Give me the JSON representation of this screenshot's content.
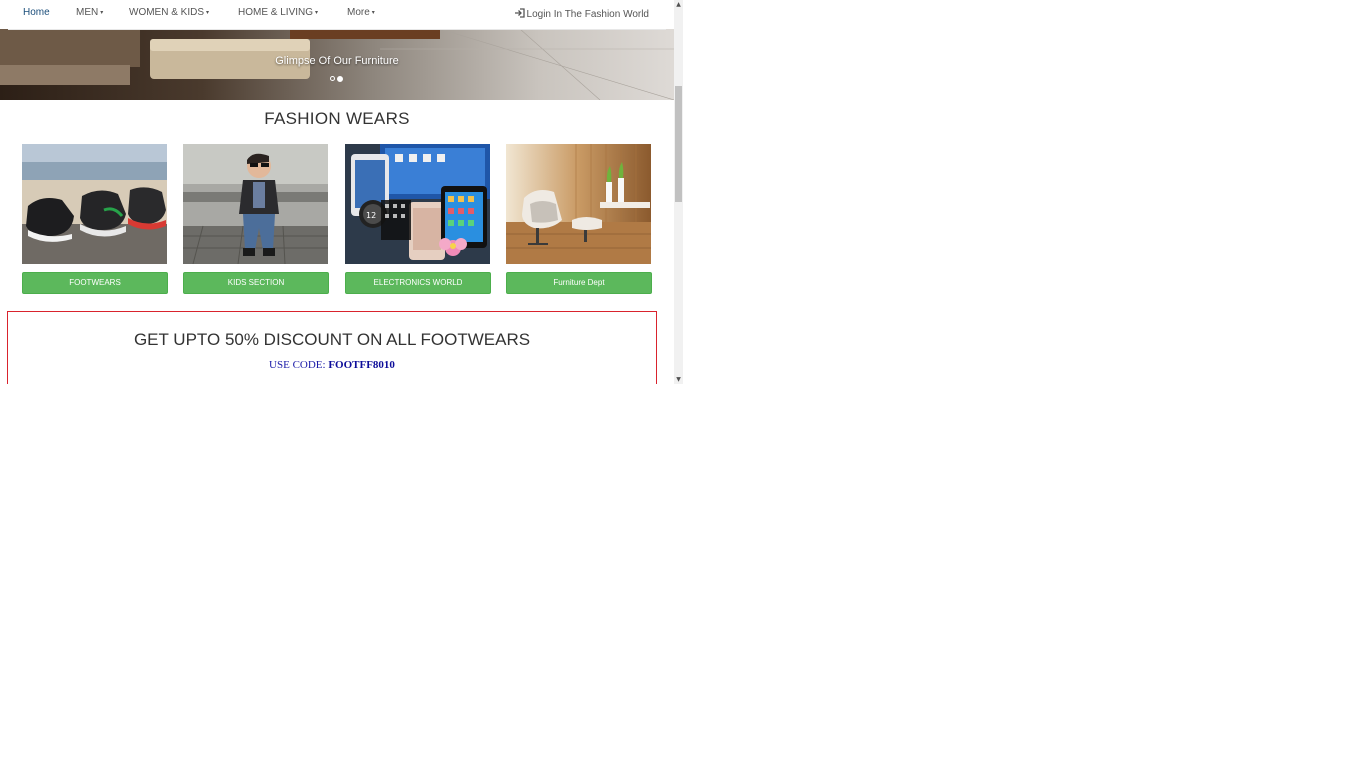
{
  "navbar": {
    "items": [
      {
        "label": "Home",
        "active": true,
        "dropdown": false
      },
      {
        "label": "MEN",
        "active": false,
        "dropdown": true
      },
      {
        "label": "WOMEN & KIDS",
        "active": false,
        "dropdown": true
      },
      {
        "label": "HOME & LIVING",
        "active": false,
        "dropdown": true
      },
      {
        "label": "More",
        "active": false,
        "dropdown": true
      }
    ],
    "caret_glyph": "▾",
    "login_label": "Login In The Fashion World",
    "login_icon": "sign-in-icon"
  },
  "carousel": {
    "caption": "Glimpse Of Our Furniture",
    "slide_count": 2,
    "active_slide": 2
  },
  "section": {
    "title": "FASHION WEARS"
  },
  "cards": [
    {
      "label": "FOOTWEARS",
      "image": "sneakers-image"
    },
    {
      "label": "KIDS SECTION",
      "image": "kid-image"
    },
    {
      "label": "ELECTRONICS WORLD",
      "image": "gadgets-image"
    },
    {
      "label": "Furniture Dept",
      "image": "furniture-image"
    }
  ],
  "discount": {
    "title": "GET UPTO 50% DISCOUNT ON ALL FOOTWEARS",
    "code_label": "USE CODE:",
    "code": "FOOTFF8010"
  },
  "colors": {
    "button_green": "#5cb85c",
    "discount_border": "#d9232d",
    "code_blue": "#1a1aa8",
    "nav_active": "#1a4d7a"
  }
}
